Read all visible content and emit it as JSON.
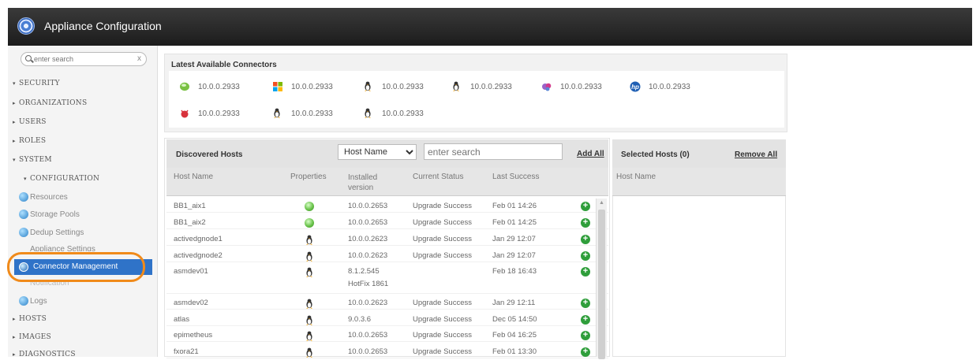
{
  "app": {
    "title": "Appliance Configuration"
  },
  "sidebar": {
    "search_placeholder": "enter search",
    "clear": "x",
    "security": "SECURITY",
    "organizations": "ORGANIZATIONS",
    "users": "USERS",
    "roles": "ROLES",
    "system": "SYSTEM",
    "configuration": "CONFIGURATION",
    "items": [
      "Resources",
      "Storage Pools",
      "Dedup Settings",
      "Appliance Settings"
    ],
    "active_item": "Connector Management",
    "notification": "Notification",
    "logs": "Logs",
    "hosts": "HOSTS",
    "images": "IMAGES",
    "diagnostics": "DIAGNOSTICS"
  },
  "connectors": {
    "heading": "Latest Available Connectors",
    "items": [
      {
        "icon": "suse-icon",
        "version": "10.0.0.2933"
      },
      {
        "icon": "windows-icon",
        "version": "10.0.0.2933"
      },
      {
        "icon": "linux-tux-icon",
        "version": "10.0.0.2933"
      },
      {
        "icon": "linux-tux-icon",
        "version": "10.0.0.2933"
      },
      {
        "icon": "solaris-icon",
        "version": "10.0.0.2933"
      },
      {
        "icon": "hp-icon",
        "version": "10.0.0.2933"
      },
      {
        "icon": "freebsd-icon",
        "version": "10.0.0.2933"
      },
      {
        "icon": "linux-tux-icon",
        "version": "10.0.0.2933"
      },
      {
        "icon": "linux-tux-icon",
        "version": "10.0.0.2933"
      }
    ]
  },
  "discovered": {
    "heading": "Discovered Hosts",
    "filter_value": "Host Name",
    "search_placeholder": "enter search",
    "add_all": "Add All",
    "columns": {
      "host": "Host Name",
      "properties": "Properties",
      "installed": "Installed version",
      "status": "Current Status",
      "last": "Last Success"
    },
    "rows": [
      {
        "host": "BB1_aix1",
        "icon": "suse-icon",
        "installed": "10.0.0.2653",
        "status": "Upgrade Success",
        "last": "Feb 01 14:26"
      },
      {
        "host": "BB1_aix2",
        "icon": "suse-icon",
        "installed": "10.0.0.2653",
        "status": "Upgrade Success",
        "last": "Feb 01 14:25"
      },
      {
        "host": "activedgnode1",
        "icon": "linux-tux-icon",
        "installed": "10.0.0.2623",
        "status": "Upgrade Success",
        "last": "Jan 29 12:07"
      },
      {
        "host": "activedgnode2",
        "icon": "linux-tux-icon",
        "installed": "10.0.0.2623",
        "status": "Upgrade Success",
        "last": "Jan 29 12:07"
      },
      {
        "host": "asmdev01",
        "icon": "linux-tux-icon",
        "installed": "8.1.2.545",
        "installed2": "HotFix 1861",
        "status": "",
        "last": "Feb 18 16:43"
      },
      {
        "host": "asmdev02",
        "icon": "linux-tux-icon",
        "installed": "10.0.0.2623",
        "status": "Upgrade Success",
        "last": "Jan 29 12:11"
      },
      {
        "host": "atlas",
        "icon": "linux-tux-icon",
        "installed": "9.0.3.6",
        "status": "Upgrade Success",
        "last": "Dec 05 14:50"
      },
      {
        "host": "epimetheus",
        "icon": "linux-tux-icon",
        "installed": "10.0.0.2653",
        "status": "Upgrade Success",
        "last": "Feb 04 16:25"
      },
      {
        "host": "fxora21",
        "icon": "linux-tux-icon",
        "installed": "10.0.0.2653",
        "status": "Upgrade Success",
        "last": "Feb 01 13:30"
      }
    ]
  },
  "selected": {
    "heading": "Selected Hosts (0)",
    "remove_all": "Remove All",
    "column": "Host Name"
  },
  "colors": {
    "accent": "#2f73c8",
    "highlight": "#f08a1a",
    "add": "#2f9e3b"
  }
}
